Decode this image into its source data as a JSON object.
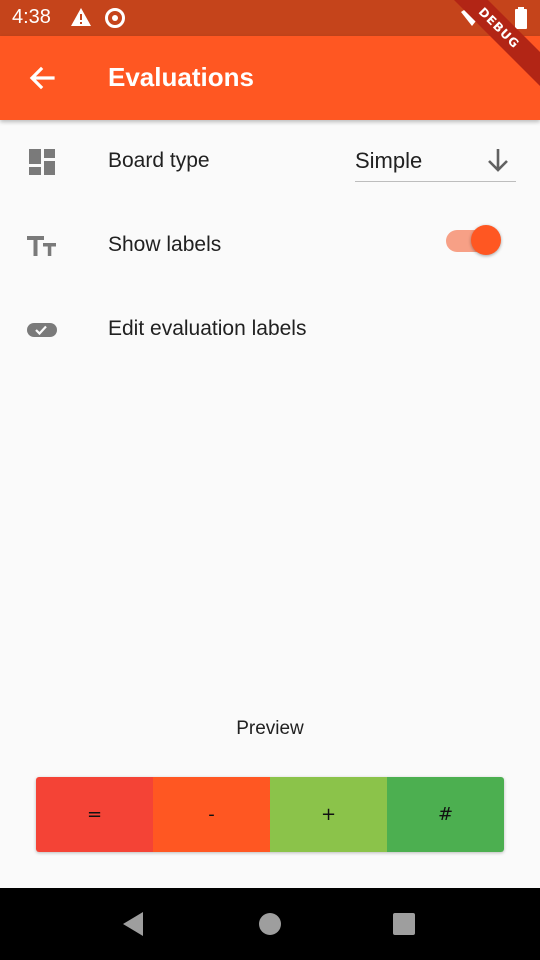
{
  "status_bar": {
    "time": "4:38"
  },
  "debug_banner": "DEBUG",
  "app_bar": {
    "title": "Evaluations"
  },
  "settings": {
    "board_type": {
      "label": "Board type",
      "value": "Simple"
    },
    "show_labels": {
      "label": "Show labels",
      "enabled": true
    },
    "edit_labels": {
      "label": "Edit evaluation labels"
    }
  },
  "preview": {
    "title": "Preview",
    "cells": [
      {
        "symbol": "=",
        "color": "#f44336"
      },
      {
        "symbol": "-",
        "color": "#ff5722"
      },
      {
        "symbol": "+",
        "color": "#8bc34a"
      },
      {
        "symbol": "#",
        "color": "#4caf50"
      }
    ]
  },
  "colors": {
    "primary": "#ff5722",
    "primary_dark": "#c5441b"
  }
}
